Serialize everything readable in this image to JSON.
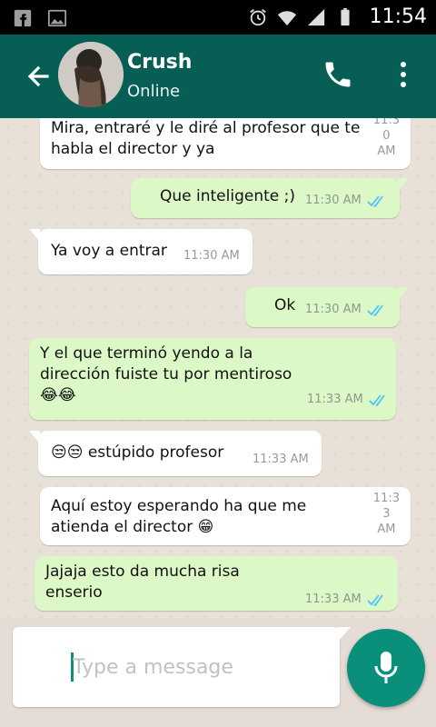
{
  "status_bar": {
    "time": "11:54",
    "icons": [
      "facebook-icon",
      "image-icon",
      "alarm-icon",
      "wifi-icon",
      "signal-icon",
      "battery-icon"
    ]
  },
  "header": {
    "contact_name": "Crush",
    "status": "Online",
    "icons": [
      "back-arrow-icon",
      "avatar",
      "phone-icon",
      "more-vert-icon"
    ]
  },
  "messages": [
    {
      "dir": "in",
      "text": "Mira, entraré y le diré al profesor que te habla el director y ya",
      "time": "11:3\n0\nAM"
    },
    {
      "dir": "out",
      "text": "Que inteligente ;)",
      "time": "11:30 AM",
      "read": true
    },
    {
      "dir": "in",
      "text": "Ya voy a entrar",
      "time": "11:30 AM"
    },
    {
      "dir": "out",
      "text": "Ok",
      "time": "11:30 AM",
      "read": true
    },
    {
      "dir": "out",
      "text": "Y el que terminó yendo a la dirección fuiste tu por mentiroso\n😂😂",
      "time": "11:33 AM",
      "read": true
    },
    {
      "dir": "in",
      "text": "😒😒 estúpido profesor",
      "time": "11:33 AM"
    },
    {
      "dir": "in",
      "text": "Aquí estoy esperando ha que me atienda el director 😁",
      "time": "11:3\n3\nAM"
    },
    {
      "dir": "out",
      "text": "Jajaja esto da mucha risa enserio",
      "time": "11:33 AM",
      "read": true
    }
  ],
  "composer": {
    "placeholder": "Type a message"
  },
  "colors": {
    "header": "#075e54",
    "outgoing_bubble": "#dcf8c6",
    "incoming_bubble": "#ffffff",
    "read_tick": "#4fc3f7",
    "mic_button": "#0a8f7b"
  }
}
